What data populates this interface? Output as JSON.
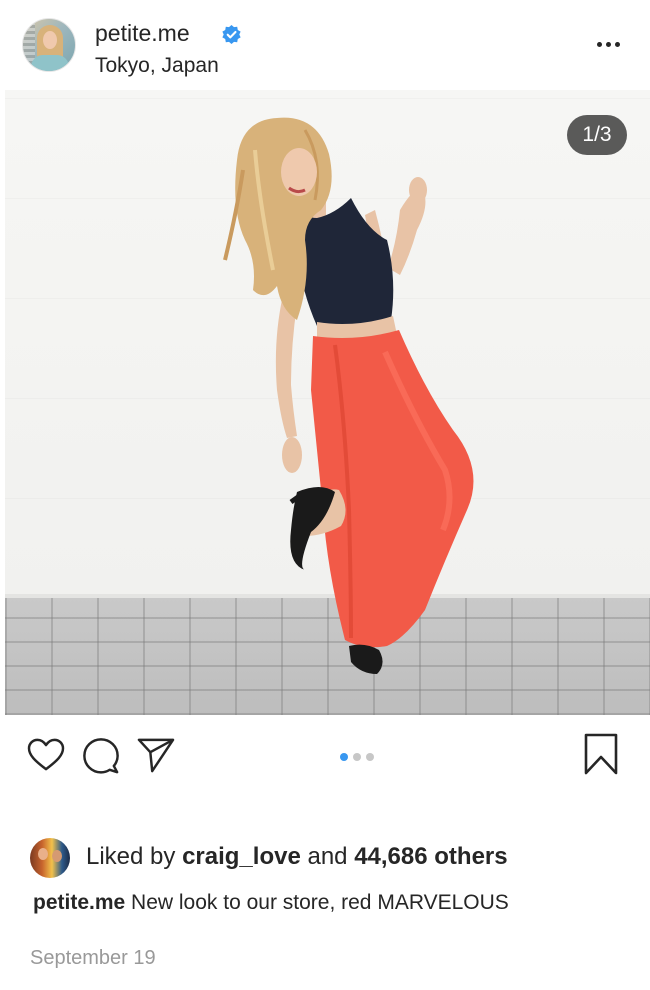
{
  "post": {
    "username": "petite.me",
    "location": "Tokyo, Japan",
    "verified": true,
    "more_icon": "more-horizontal-icon",
    "image_counter": "1/3",
    "carousel": {
      "count": 3,
      "active_index": 0
    }
  },
  "actions": {
    "like_icon": "heart-icon",
    "comment_icon": "comment-icon",
    "share_icon": "send-icon",
    "save_icon": "bookmark-icon"
  },
  "likes": {
    "prefix": "Liked by",
    "liker": "craig_love",
    "joiner": "and",
    "count_text": "44,686 others"
  },
  "caption": {
    "username": "petite.me",
    "text": "New look to our store, red MARVELOUS"
  },
  "date": "September 19",
  "colors": {
    "text": "#262626",
    "muted": "#999999",
    "accent": "#3897f0",
    "verified": "#3897f0",
    "pants": "#f25a48"
  }
}
